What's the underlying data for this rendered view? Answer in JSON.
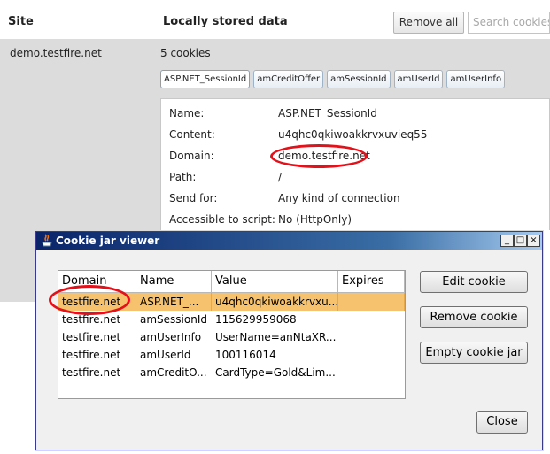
{
  "header": {
    "site_col": "Site",
    "data_col": "Locally stored data",
    "remove_all": "Remove all",
    "search_placeholder": "Search cookies"
  },
  "site": {
    "name": "demo.testfire.net",
    "count": "5 cookies",
    "chips": [
      "ASP.NET_SessionId",
      "amCreditOffer",
      "amSessionId",
      "amUserId",
      "amUserInfo"
    ]
  },
  "details": {
    "rows": [
      {
        "label": "Name:",
        "value": "ASP.NET_SessionId"
      },
      {
        "label": "Content:",
        "value": "u4qhc0qkiwoakkrvxuvieq55"
      },
      {
        "label": "Domain:",
        "value": "demo.testfire.net"
      },
      {
        "label": "Path:",
        "value": "/"
      },
      {
        "label": "Send for:",
        "value": "Any kind of connection"
      },
      {
        "label": "Accessible to script:",
        "value": "No (HttpOnly)"
      }
    ]
  },
  "dialog": {
    "title": "Cookie jar viewer",
    "columns": [
      "Domain",
      "Name",
      "Value",
      "Expires"
    ],
    "rows": [
      {
        "domain": "testfire.net",
        "name": "ASP.NET_...",
        "value": "u4qhc0qkiwoakkrvxu...",
        "expires": ""
      },
      {
        "domain": "testfire.net",
        "name": "amSessionId",
        "value": "115629959068",
        "expires": ""
      },
      {
        "domain": "testfire.net",
        "name": "amUserInfo",
        "value": "UserName=anNtaXR...",
        "expires": ""
      },
      {
        "domain": "testfire.net",
        "name": "amUserId",
        "value": "100116014",
        "expires": ""
      },
      {
        "domain": "testfire.net",
        "name": "amCreditO...",
        "value": "CardType=Gold&Lim...",
        "expires": ""
      }
    ],
    "buttons": {
      "edit": "Edit cookie",
      "remove": "Remove cookie",
      "empty": "Empty cookie jar",
      "close": "Close"
    },
    "window_controls": {
      "minimize": "_",
      "maximize": "□",
      "close": "×"
    }
  },
  "colors": {
    "annotation_red": "#e3111a",
    "selected_row": "#f6c26e",
    "titlebar_dark": "#0a246a"
  }
}
